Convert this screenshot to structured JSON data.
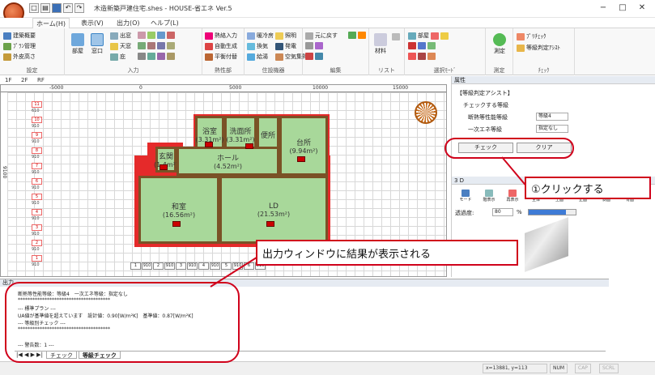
{
  "window": {
    "title": "木造新築戸建住宅.shes - HOUSE-省エネ Ver.5",
    "minimize": "−",
    "maximize": "□",
    "close": "✕"
  },
  "ribbon_tabs": [
    "ホーム(H)",
    "表示(V)",
    "出力(O)",
    "ヘルプ(L)"
  ],
  "ribbon": {
    "settings": {
      "label": "設定",
      "items": [
        "建築概要",
        "ﾌﾟﾗﾝ管理",
        "外皮高さ"
      ]
    },
    "input": {
      "label": "入力",
      "big": [
        "部屋",
        "窓口"
      ],
      "items": [
        "出窓",
        "天窓",
        "庇"
      ]
    },
    "insulation": {
      "label": "熱性部",
      "items": [
        "熱絡入力",
        "自動生成",
        "平衡付替"
      ]
    },
    "equipment": {
      "label": "住設機器",
      "items": [
        "暖冷房",
        "照明",
        "換気",
        "発電",
        "給湯",
        "空気集熱"
      ]
    },
    "edit": {
      "label": "編集",
      "items": [
        "元に戻す"
      ]
    },
    "list": {
      "label": "リスト",
      "items": [
        "材料"
      ]
    },
    "select_mode": {
      "label": "選択ﾓｰﾄﾞ",
      "items": [
        "部屋"
      ]
    },
    "measure": {
      "label": "測定",
      "big": [
        "測定"
      ]
    },
    "check": {
      "label": "ﾁｪｯｸ",
      "items": [
        "ﾌﾟﾘﾁｪｯｸ",
        "等級判定ｱｼｽﾄ"
      ]
    }
  },
  "floor_tabs": [
    "1F",
    "2F",
    "RF"
  ],
  "ruler": [
    "-5000",
    "0",
    "5000",
    "10000",
    "15000"
  ],
  "left_levels": [
    {
      "btn": "11",
      "val": "610"
    },
    {
      "btn": "10",
      "val": "910"
    },
    {
      "btn": "9",
      "val": "910"
    },
    {
      "btn": "8",
      "val": "910"
    },
    {
      "btn": "7",
      "val": "910"
    },
    {
      "btn": "6",
      "val": "910"
    },
    {
      "btn": "5",
      "val": "910"
    },
    {
      "btn": "4",
      "val": "910"
    },
    {
      "btn": "3",
      "val": "910"
    },
    {
      "btn": "2",
      "val": "910"
    },
    {
      "btn": "1",
      "val": "910"
    }
  ],
  "side_dim": "9100",
  "rooms": [
    {
      "name": "浴室",
      "area": "(3.31m²)"
    },
    {
      "name": "洗面所",
      "area": "(3.31m²)"
    },
    {
      "name": "便所",
      "area": ""
    },
    {
      "name": "台所",
      "area": "(9.94m²)"
    },
    {
      "name": "玄関",
      "area": "(1.4m²)"
    },
    {
      "name": "ホール",
      "area": "(4.52m²)"
    },
    {
      "name": "和室",
      "area": "(16.56m²)"
    },
    {
      "name": "LD",
      "area": "(21.53m²)"
    }
  ],
  "bottom_dims": [
    "1",
    "910",
    "2",
    "910",
    "3",
    "910",
    "4",
    "910",
    "5",
    "910",
    "6",
    "910"
  ],
  "properties": {
    "title": "属性",
    "section": "【等級判定アシスト】",
    "subsection": "チェックする等級",
    "insulation_label": "断熱等性能等級",
    "insulation_value": "等級4",
    "energy_label": "一次エネ等級",
    "energy_value": "指定なし",
    "check_button": "チェック",
    "clear_button": "クリア"
  },
  "view3d": {
    "title": "3 D",
    "tools": [
      "モード",
      "階表示",
      "再表示",
      "全体",
      "上面",
      "正面",
      "側面",
      "背面"
    ],
    "transparency_label": "透過度:",
    "transparency_value": "80",
    "transparency_unit": "%"
  },
  "output": {
    "title": "出力",
    "lines": [
      "断熱等性能等級：等級4　一次エネ等級：指定なし",
      "**************************************",
      "--- 標準プラン ---",
      "UA値が基準値を超えています　設計値：0.90[W/m²K]　基準値：0.87[W/m²K]",
      "--- 等級別チェック ---",
      "**************************************",
      "",
      "--- 警告数：1 ---"
    ],
    "tabs": [
      "チェック",
      "等級チェック"
    ]
  },
  "status": {
    "coords": "x=13881, y=113",
    "num": "NUM",
    "cap": "CAP",
    "scrl": "SCRL"
  },
  "callouts": {
    "click": "①クリックする",
    "result": "出力ウィンドウに結果が表示される"
  },
  "colors": {
    "accent_red": "#d0021b",
    "room_green": "#a8d89a",
    "wall_red": "#e52a2a"
  }
}
